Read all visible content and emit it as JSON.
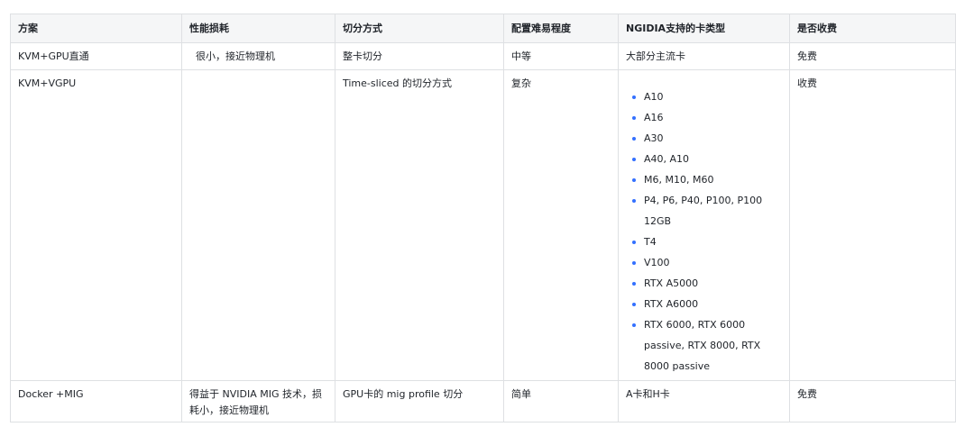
{
  "headers": [
    "方案",
    "性能损耗",
    "切分方式",
    "配置难易程度",
    "NGIDIA支持的卡类型",
    "是否收费"
  ],
  "rows": [
    {
      "scheme": "KVM+GPU直通",
      "perf": " 很小，接近物理机",
      "split": "整卡切分",
      "difficulty": "中等",
      "cards": "大部分主流卡",
      "fee": "免费"
    },
    {
      "scheme": "KVM+VGPU",
      "perf": "",
      "split": "Time-sliced 的切分方式",
      "difficulty": "复杂",
      "card_list": [
        "A10",
        "A16",
        "A30",
        "A40, A10",
        "M6, M10, M60",
        "P4, P6, P40, P100, P100 12GB",
        "T4",
        "V100",
        "RTX A5000",
        "RTX A6000",
        "RTX 6000, RTX 6000 passive, RTX 8000, RTX 8000 passive"
      ],
      "fee": "收费"
    },
    {
      "scheme": "Docker +MIG",
      "perf": "得益于 NVIDIA MIG 技术，损耗小，接近物理机",
      "split": "GPU卡的  mig profile 切分",
      "difficulty": "简单",
      "cards": "A卡和H卡",
      "fee": "免费"
    }
  ]
}
